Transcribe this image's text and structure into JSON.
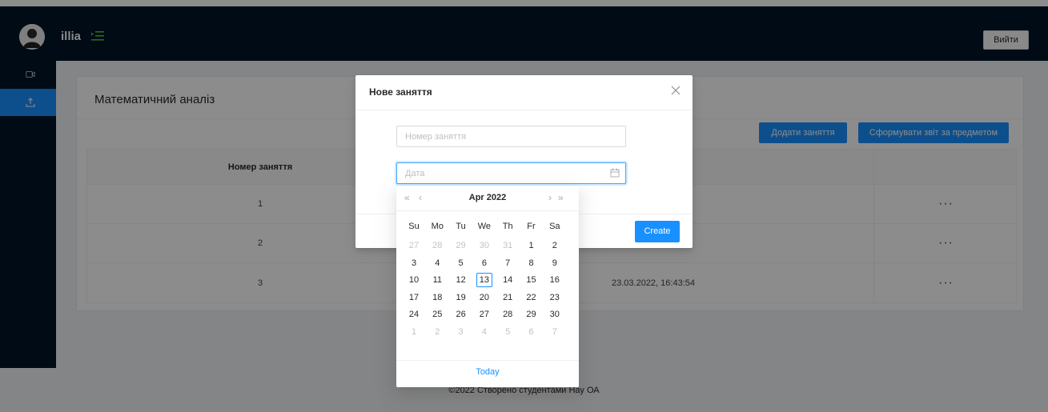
{
  "header": {
    "username": "illia",
    "logout_label": "Вийти"
  },
  "sidebar": {
    "items": [
      {
        "icon": "video-camera-icon"
      },
      {
        "icon": "upload-icon",
        "active": true
      }
    ]
  },
  "card": {
    "title": "Математичний аналіз",
    "add_label": "Додати заняття",
    "report_label": "Сформувати звіт за предметом",
    "table": {
      "headers": [
        "Номер заняття",
        "",
        ""
      ],
      "rows": [
        {
          "num": "1",
          "date": "",
          "action": "···"
        },
        {
          "num": "2",
          "date": "",
          "action": "···"
        },
        {
          "num": "3",
          "date": "23.03.2022, 16:43:54",
          "action": "···"
        }
      ]
    }
  },
  "modal": {
    "title": "Нове заняття",
    "number_placeholder": "Номер заняття",
    "date_placeholder": "Дата",
    "create_label": "Create"
  },
  "datepicker": {
    "month": "Apr",
    "year": "2022",
    "super_prev": "«",
    "prev": "‹",
    "next": "›",
    "super_next": "»",
    "weekdays": [
      "Su",
      "Mo",
      "Tu",
      "We",
      "Th",
      "Fr",
      "Sa"
    ],
    "weeks": [
      [
        "27",
        "28",
        "29",
        "30",
        "31",
        "1",
        "2"
      ],
      [
        "3",
        "4",
        "5",
        "6",
        "7",
        "8",
        "9"
      ],
      [
        "10",
        "11",
        "12",
        "13",
        "14",
        "15",
        "16"
      ],
      [
        "17",
        "18",
        "19",
        "20",
        "21",
        "22",
        "23"
      ],
      [
        "24",
        "25",
        "26",
        "27",
        "28",
        "29",
        "30"
      ],
      [
        "1",
        "2",
        "3",
        "4",
        "5",
        "6",
        "7"
      ]
    ],
    "today_label": "Today"
  },
  "footer": {
    "text": "©2022 Створено студентами Нау ОА"
  },
  "colors": {
    "primary": "#1890ff",
    "sider": "#001529",
    "background": "#f0f2f5"
  }
}
